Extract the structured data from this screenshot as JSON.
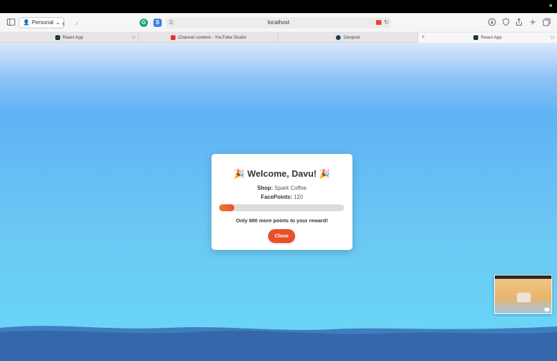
{
  "browser": {
    "profile_label": "Personal",
    "address_url": "localhost"
  },
  "tabs": [
    {
      "label": "React App"
    },
    {
      "label": "Channel content - YouTube Studio"
    },
    {
      "label": "Devpost"
    },
    {
      "label": "React App"
    }
  ],
  "icons": {
    "sidebar": "sidebar-icon",
    "back": "chevron-left-icon",
    "forward": "chevron-right-icon",
    "download": "download-icon",
    "privacy": "shield-icon",
    "share": "share-icon",
    "new_tab": "plus-icon",
    "tab_overview": "tabs-icon"
  },
  "modal": {
    "emoji": "🎉",
    "title": "Welcome, Davu!",
    "shop_label": "Shop:",
    "shop_value": "Spark Coffee",
    "points_label": "FacePoints:",
    "points_value": "120",
    "progress_fraction": 0.12,
    "message": "Only 880 more points to your reward!",
    "close_label": "Close"
  },
  "colors": {
    "accent": "#e8502a",
    "progress_track": "#dcdcdc"
  }
}
